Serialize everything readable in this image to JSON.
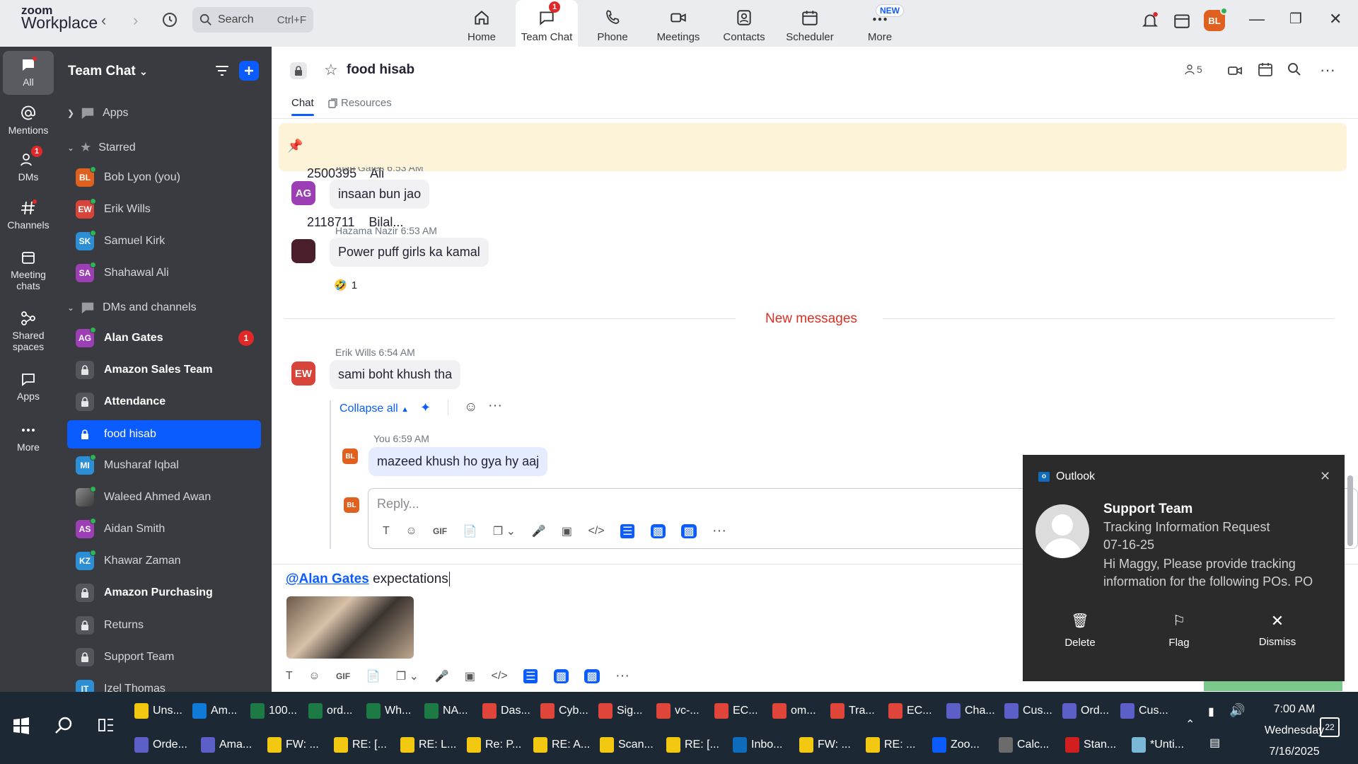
{
  "app": {
    "logo_line1": "zoom",
    "logo_line2": "Workplace"
  },
  "search": {
    "label": "Search",
    "shortcut": "Ctrl+F"
  },
  "topnav": [
    {
      "label": "Home"
    },
    {
      "label": "Team Chat",
      "badge": "1"
    },
    {
      "label": "Phone"
    },
    {
      "label": "Meetings"
    },
    {
      "label": "Contacts"
    },
    {
      "label": "Scheduler"
    },
    {
      "label": "More",
      "badge": "NEW"
    }
  ],
  "user_avatar": "BL",
  "rail": [
    {
      "label": "All"
    },
    {
      "label": "Mentions"
    },
    {
      "label": "DMs",
      "badge": "1"
    },
    {
      "label": "Channels"
    },
    {
      "label": "Meeting chats"
    },
    {
      "label": "Shared spaces"
    },
    {
      "label": "Apps"
    },
    {
      "label": "More"
    }
  ],
  "sidebar": {
    "title": "Team Chat",
    "apps_label": "Apps",
    "starred_label": "Starred",
    "starred": [
      {
        "initials": "BL",
        "name": "Bob Lyon (you)",
        "color": "#e0611f"
      },
      {
        "initials": "EW",
        "name": "Erik Wills",
        "color": "#d9443a"
      },
      {
        "initials": "SK",
        "name": "Samuel Kirk",
        "color": "#2c8fd6"
      },
      {
        "initials": "SA",
        "name": "Shahawal Ali",
        "color": "#9c3fb4"
      }
    ],
    "dms_label": "DMs and channels",
    "dms": [
      {
        "initials": "AG",
        "name": "Alan Gates",
        "bold": true,
        "badge": "1",
        "color": "#9c3fb4"
      },
      {
        "name": "Amazon Sales Team",
        "bold": true,
        "locked": true
      },
      {
        "name": "Attendance",
        "bold": true,
        "locked": true
      },
      {
        "name": "food hisab",
        "locked": true,
        "selected": true
      },
      {
        "initials": "MI",
        "name": "Musharaf Iqbal",
        "color": "#2c8fd6"
      },
      {
        "initials": "",
        "name": "Waleed Ahmed Awan",
        "color": "#6b6b6b"
      },
      {
        "initials": "AS",
        "name": "Aidan Smith",
        "color": "#9c3fb4"
      },
      {
        "initials": "KZ",
        "name": "Khawar Zaman",
        "color": "#2c8fd6"
      },
      {
        "name": "Amazon Purchasing",
        "bold": true,
        "locked": true
      },
      {
        "name": "Returns",
        "locked": true
      },
      {
        "name": "Support Team",
        "locked": true
      },
      {
        "initials": "IT",
        "name": "Izel Thomas",
        "color": "#2c8fd6"
      }
    ]
  },
  "channel": {
    "name": "food hisab",
    "members": "5",
    "tabs": [
      "Chat",
      "Resources"
    ],
    "pinned_line1": "2500395    Ali",
    "pinned_line2": "2118711    Bilal..."
  },
  "messages": {
    "m1_meta": "Alan Gates 6:53 AM",
    "m1_initials": "AG",
    "m1_text": "insaan bun jao",
    "m2_meta": "Hazama Nazir 6:53 AM",
    "m2_text": "Power puff girls ka kamal",
    "m2_reaction": "🤣",
    "m2_reaction_count": "1",
    "divider": "New messages",
    "m3_meta": "Erik Wills 6:54 AM",
    "m3_initials": "EW",
    "m3_text": "sami boht khush tha",
    "collapse": "Collapse all",
    "reply_meta": "You 6:59 AM",
    "reply_initials": "BL",
    "reply_text": "mazeed khush ho gya hy aaj",
    "reply_placeholder": "Reply..."
  },
  "compose": {
    "mention": "@Alan Gates",
    "text": " expectations"
  },
  "notification": {
    "app": "Outlook",
    "sender": "Support Team",
    "subject": "Tracking Information Request",
    "date": "07-16-25",
    "body": "Hi Maggy,  Please provide tracking information for the following POs.  PO",
    "actions": [
      "Delete",
      "Flag",
      "Dismiss"
    ]
  },
  "taskbar": {
    "row1": [
      {
        "label": "Uns...",
        "color": "#f2c811"
      },
      {
        "label": "Am...",
        "color": "#0f7bd6"
      },
      {
        "label": "100...",
        "color": "#1d7a45"
      },
      {
        "label": "ord...",
        "color": "#1d7a45"
      },
      {
        "label": "Wh...",
        "color": "#1d7a45"
      },
      {
        "label": "NA...",
        "color": "#1d7a45"
      },
      {
        "label": "Das...",
        "color": "#e0453a"
      },
      {
        "label": "Cyb...",
        "color": "#e0453a"
      },
      {
        "label": "Sig...",
        "color": "#e0453a"
      },
      {
        "label": "vc-...",
        "color": "#e0453a"
      },
      {
        "label": "EC...",
        "color": "#e0453a"
      },
      {
        "label": "om...",
        "color": "#e0453a"
      },
      {
        "label": "Tra...",
        "color": "#e0453a"
      },
      {
        "label": "EC...",
        "color": "#e0453a"
      },
      {
        "label": "Cha...",
        "color": "#5b5fc7"
      },
      {
        "label": "Cus...",
        "color": "#5b5fc7"
      },
      {
        "label": "Ord...",
        "color": "#5b5fc7"
      },
      {
        "label": "Cus...",
        "color": "#5b5fc7"
      }
    ],
    "row2": [
      {
        "label": "Orde...",
        "color": "#5b5fc7"
      },
      {
        "label": "Ama...",
        "color": "#5b5fc7"
      },
      {
        "label": "FW: ...",
        "color": "#f2c811"
      },
      {
        "label": "RE: [...",
        "color": "#f2c811"
      },
      {
        "label": "RE: L...",
        "color": "#f2c811"
      },
      {
        "label": "Re: P...",
        "color": "#f2c811"
      },
      {
        "label": "RE: A...",
        "color": "#f2c811"
      },
      {
        "label": "Scan...",
        "color": "#f2c811"
      },
      {
        "label": "RE: [...",
        "color": "#f2c811"
      },
      {
        "label": "Inbo...",
        "color": "#0f6cbd"
      },
      {
        "label": "FW: ...",
        "color": "#f2c811"
      },
      {
        "label": "RE: ...",
        "color": "#f2c811"
      },
      {
        "label": "Zoo...",
        "color": "#0b5cff"
      },
      {
        "label": "Calc...",
        "color": "#6b6b6b"
      },
      {
        "label": "Stan...",
        "color": "#d11f1f"
      },
      {
        "label": "*Unti...",
        "color": "#7ab8d6"
      }
    ],
    "time": "7:00 AM",
    "day": "Wednesday",
    "date": "7/16/2025",
    "notif_count": "22"
  }
}
